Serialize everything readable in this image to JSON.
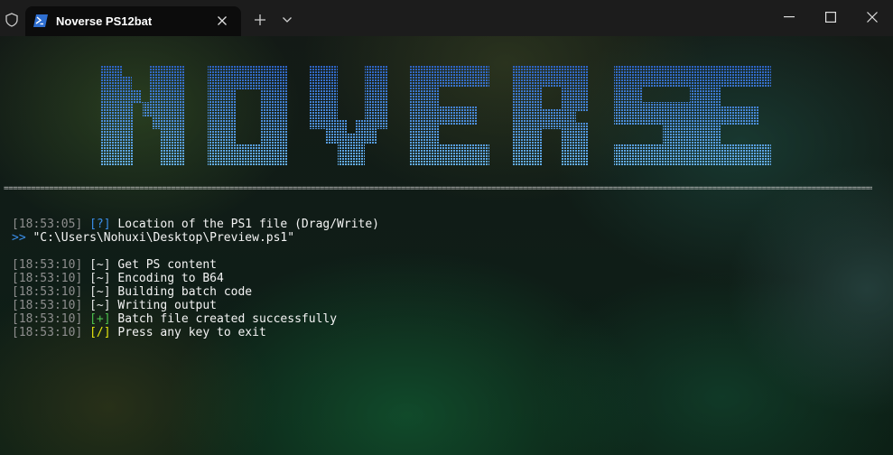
{
  "tab": {
    "title": "Noverse PS12bat"
  },
  "banner": {
    "text": "NOVERSE",
    "color_top": "#2f68c9",
    "color_bottom": "#5fa6e6"
  },
  "separator": {
    "char": "="
  },
  "console": {
    "lines": [
      {
        "ts": "[18:53:05]",
        "tag": "[?]",
        "tag_type": "question",
        "msg": "Location of the PS1 file (Drag/Write)"
      },
      {
        "prompt": ">>",
        "msg": "\"C:\\Users\\Nohuxi\\Desktop\\Preview.ps1\""
      },
      {
        "blank": true
      },
      {
        "ts": "[18:53:10]",
        "tag": "[~]",
        "tag_type": "work",
        "msg": "Get PS content"
      },
      {
        "ts": "[18:53:10]",
        "tag": "[~]",
        "tag_type": "work",
        "msg": "Encoding to B64"
      },
      {
        "ts": "[18:53:10]",
        "tag": "[~]",
        "tag_type": "work",
        "msg": "Building batch code"
      },
      {
        "ts": "[18:53:10]",
        "tag": "[~]",
        "tag_type": "work",
        "msg": "Writing output"
      },
      {
        "ts": "[18:53:10]",
        "tag": "[+]",
        "tag_type": "success",
        "msg": "Batch file created successfully"
      },
      {
        "ts": "[18:53:10]",
        "tag": "[/]",
        "tag_type": "exit",
        "msg": "Press any key to exit"
      }
    ]
  },
  "icons": {
    "shield": "shield-icon",
    "tab": "powershell-icon",
    "close": "close-icon",
    "new_tab": "plus-icon",
    "dropdown": "chevron-down-icon",
    "minimize": "minimize-icon",
    "maximize": "maximize-icon",
    "window_close": "close-icon"
  }
}
